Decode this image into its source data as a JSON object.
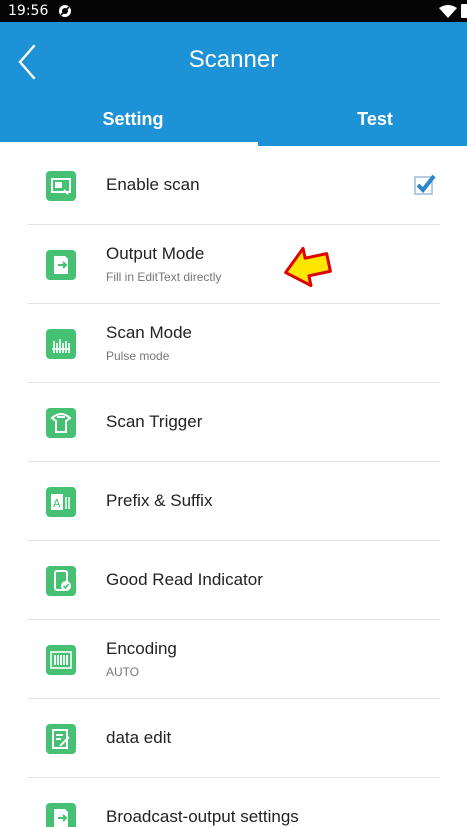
{
  "status_bar": {
    "time": "19:56",
    "icons": [
      "app-notification-icon",
      "wifi-icon",
      "battery-icon"
    ]
  },
  "header": {
    "title": "Scanner",
    "back_icon": "chevron-left-icon"
  },
  "tabs": [
    {
      "label": "Setting",
      "selected": true
    },
    {
      "label": "Test",
      "selected": false
    }
  ],
  "settings": [
    {
      "title": "Enable scan",
      "icon": "enable-scan-icon",
      "checked": true
    },
    {
      "title": "Output Mode",
      "subtitle": "Fill in EditText directly",
      "icon": "output-mode-icon"
    },
    {
      "title": "Scan Mode",
      "subtitle": "Pulse mode",
      "icon": "scan-mode-icon"
    },
    {
      "title": "Scan Trigger",
      "icon": "scan-trigger-icon"
    },
    {
      "title": "Prefix & Suffix",
      "icon": "prefix-suffix-icon"
    },
    {
      "title": "Good Read Indicator",
      "icon": "good-read-indicator-icon"
    },
    {
      "title": "Encoding",
      "subtitle": "AUTO",
      "icon": "encoding-icon"
    },
    {
      "title": "data edit",
      "icon": "data-edit-icon"
    },
    {
      "title": "Broadcast-output settings",
      "icon": "broadcast-output-icon"
    }
  ],
  "colors": {
    "app_bar": "#1e92d6",
    "icon_green": "#46c173",
    "checkbox": "#2a86c8",
    "annotation_arrow": "#ffe600",
    "annotation_outline": "#e00000"
  }
}
